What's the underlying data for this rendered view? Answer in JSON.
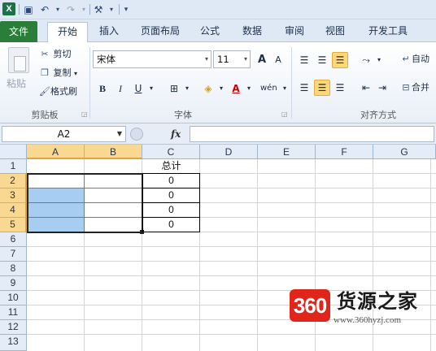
{
  "app": {
    "logo_letter": "X"
  },
  "qat": {
    "undo_glyph": "↶",
    "redo_glyph": "↷",
    "save_glyph": "💾",
    "tool_glyph": "⚒",
    "more_glyph": "▾"
  },
  "tabs": [
    {
      "label": "文件"
    },
    {
      "label": "开始"
    },
    {
      "label": "插入"
    },
    {
      "label": "页面布局"
    },
    {
      "label": "公式"
    },
    {
      "label": "数据"
    },
    {
      "label": "审阅"
    },
    {
      "label": "视图"
    },
    {
      "label": "开发工具"
    }
  ],
  "ribbon": {
    "clipboard": {
      "paste": "粘贴",
      "cut": "剪切",
      "copy": "复制",
      "format_painter": "格式刷",
      "group": "剪贴板"
    },
    "font": {
      "name": "宋体",
      "size": "11",
      "bold": "B",
      "italic": "I",
      "underline": "U",
      "group": "字体",
      "grow": "A",
      "shrink": "A"
    },
    "align": {
      "wrap": "自动",
      "merge": "合并",
      "group": "对齐方式"
    }
  },
  "formula_bar": {
    "name_box": "A2",
    "fx": "fx",
    "value": ""
  },
  "sheet": {
    "columns": [
      "A",
      "B",
      "C",
      "D",
      "E",
      "F",
      "G"
    ],
    "rows": [
      "1",
      "2",
      "3",
      "4",
      "5",
      "6",
      "7",
      "8",
      "9",
      "10",
      "11",
      "12",
      "13"
    ],
    "selected_range": "A2:B5",
    "cells": {
      "C1": "总计",
      "C2": "0",
      "C3": "0",
      "C4": "0",
      "C5": "0"
    }
  },
  "watermark": {
    "badge": "360",
    "title": "货源之家",
    "url": "www.360hyzj.com"
  },
  "colors": {
    "file_tab": "#2b7d3a",
    "selection": "#a7cdf0",
    "header_highlight": "#f9d992",
    "watermark_red": "#e1251b"
  }
}
